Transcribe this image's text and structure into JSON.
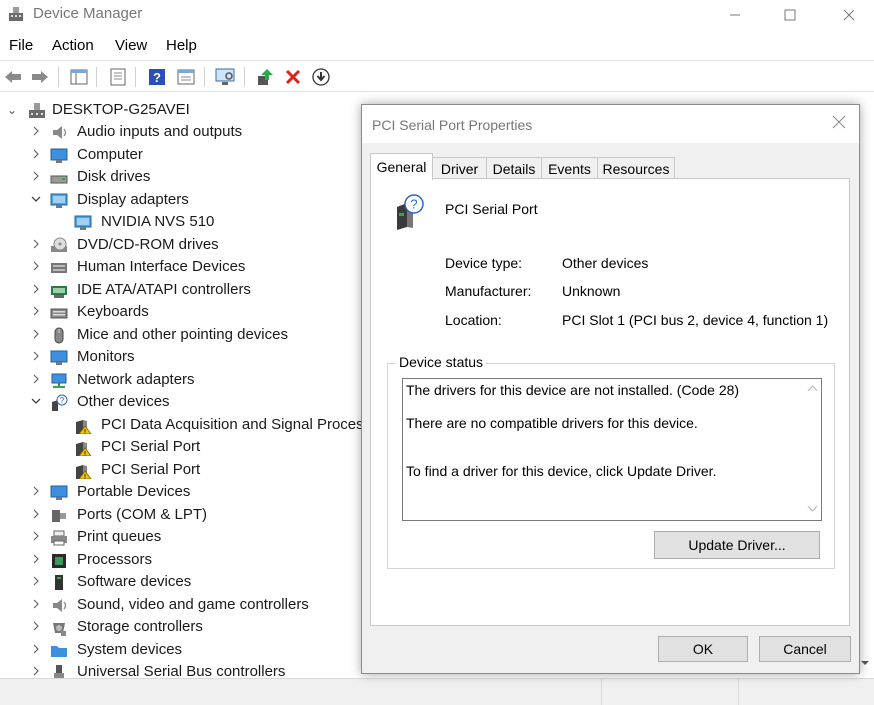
{
  "window": {
    "title": "Device Manager",
    "minimize_glyph": "—",
    "maximize_glyph": "☐",
    "close_glyph": "✕"
  },
  "menu": [
    "File",
    "Action",
    "View",
    "Help"
  ],
  "toolbar": {
    "icons": [
      "back-arrow-icon",
      "forward-arrow-icon",
      "show-hide-tree-icon",
      "properties-icon",
      "help-icon",
      "view-icon",
      "scan-hardware-icon",
      "update-driver-icon",
      "uninstall-icon",
      "download-icon"
    ]
  },
  "tree": {
    "root": "DESKTOP-G25AVEI",
    "items": [
      {
        "label": "Audio inputs and outputs",
        "level": 1,
        "state": "collapsed",
        "icon": "speaker-icon"
      },
      {
        "label": "Computer",
        "level": 1,
        "state": "collapsed",
        "icon": "monitor-icon"
      },
      {
        "label": "Disk drives",
        "level": 1,
        "state": "collapsed",
        "icon": "disk-icon"
      },
      {
        "label": "Display adapters",
        "level": 1,
        "state": "expanded",
        "icon": "display-adapter-icon"
      },
      {
        "label": "NVIDIA NVS 510",
        "level": 2,
        "state": "none",
        "icon": "display-adapter-icon"
      },
      {
        "label": "DVD/CD-ROM drives",
        "level": 1,
        "state": "collapsed",
        "icon": "dvd-icon"
      },
      {
        "label": "Human Interface Devices",
        "level": 1,
        "state": "collapsed",
        "icon": "hid-icon"
      },
      {
        "label": "IDE ATA/ATAPI controllers",
        "level": 1,
        "state": "collapsed",
        "icon": "ide-icon"
      },
      {
        "label": "Keyboards",
        "level": 1,
        "state": "collapsed",
        "icon": "keyboard-icon"
      },
      {
        "label": "Mice and other pointing devices",
        "level": 1,
        "state": "collapsed",
        "icon": "mouse-icon"
      },
      {
        "label": "Monitors",
        "level": 1,
        "state": "collapsed",
        "icon": "monitor-icon"
      },
      {
        "label": "Network adapters",
        "level": 1,
        "state": "collapsed",
        "icon": "network-icon"
      },
      {
        "label": "Other devices",
        "level": 1,
        "state": "expanded",
        "icon": "unknown-device-icon"
      },
      {
        "label": "PCI Data Acquisition and Signal Process",
        "level": 2,
        "state": "none",
        "icon": "warning-device-icon"
      },
      {
        "label": "PCI Serial Port",
        "level": 2,
        "state": "none",
        "icon": "warning-device-icon"
      },
      {
        "label": "PCI Serial Port",
        "level": 2,
        "state": "none",
        "icon": "warning-device-icon"
      },
      {
        "label": "Portable Devices",
        "level": 1,
        "state": "collapsed",
        "icon": "monitor-icon"
      },
      {
        "label": "Ports (COM & LPT)",
        "level": 1,
        "state": "collapsed",
        "icon": "port-icon"
      },
      {
        "label": "Print queues",
        "level": 1,
        "state": "collapsed",
        "icon": "printer-icon"
      },
      {
        "label": "Processors",
        "level": 1,
        "state": "collapsed",
        "icon": "processor-icon"
      },
      {
        "label": "Software devices",
        "level": 1,
        "state": "collapsed",
        "icon": "software-device-icon"
      },
      {
        "label": "Sound, video and game controllers",
        "level": 1,
        "state": "collapsed",
        "icon": "speaker-icon"
      },
      {
        "label": "Storage controllers",
        "level": 1,
        "state": "collapsed",
        "icon": "storage-icon"
      },
      {
        "label": "System devices",
        "level": 1,
        "state": "collapsed",
        "icon": "folder-icon"
      },
      {
        "label": "Universal Serial Bus controllers",
        "level": 1,
        "state": "collapsed",
        "icon": "usb-icon"
      }
    ]
  },
  "dialog": {
    "title": "PCI Serial Port Properties",
    "close_glyph": "✕",
    "tabs": [
      "General",
      "Driver",
      "Details",
      "Events",
      "Resources"
    ],
    "active_tab": "General",
    "device_name": "PCI Serial Port",
    "properties": [
      {
        "label": "Device type:",
        "value": "Other devices"
      },
      {
        "label": "Manufacturer:",
        "value": "Unknown"
      },
      {
        "label": "Location:",
        "value": "PCI Slot 1 (PCI bus 2, device 4, function 1)"
      }
    ],
    "status_group_title": "Device status",
    "status_lines": [
      "The drivers for this device are not installed. (Code 28)",
      "There are no compatible drivers for this device.",
      "To find a driver for this device, click Update Driver."
    ],
    "update_driver_label": "Update Driver...",
    "ok_label": "OK",
    "cancel_label": "Cancel"
  },
  "colors": {
    "warning": "#f2c500",
    "error_red": "#e0201a",
    "accent_blue": "#1f6fd1"
  }
}
